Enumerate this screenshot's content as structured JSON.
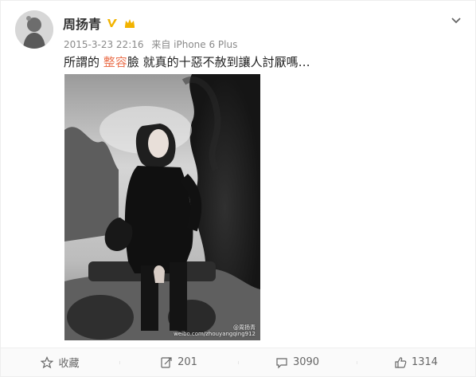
{
  "author": {
    "name": "周扬青"
  },
  "meta": {
    "date": "2015-3-23 22:16",
    "source": "来自 iPhone 6 Plus"
  },
  "post": {
    "prefix": "所謂的 ",
    "tag": "整容",
    "suffix": "臉 就真的十惡不赦到讓人討厭嗎…",
    "image_watermark_line1": "@周扬青",
    "image_watermark_line2": "weibo.com/zhouyangqing912"
  },
  "actions": {
    "favorite_label": "收藏",
    "repost_count": "201",
    "comment_count": "3090",
    "like_count": "1314"
  },
  "colors": {
    "tag": "#eb7350",
    "verified_badge": "#f2b300",
    "text_secondary": "#8a8a8a"
  },
  "icons": {
    "badge1": "verified-v-icon",
    "badge2": "crown-icon",
    "chevron": "chevron-down-icon",
    "favorite": "star-icon",
    "repost": "repost-icon",
    "comment": "comment-icon",
    "like": "thumbs-up-icon"
  }
}
